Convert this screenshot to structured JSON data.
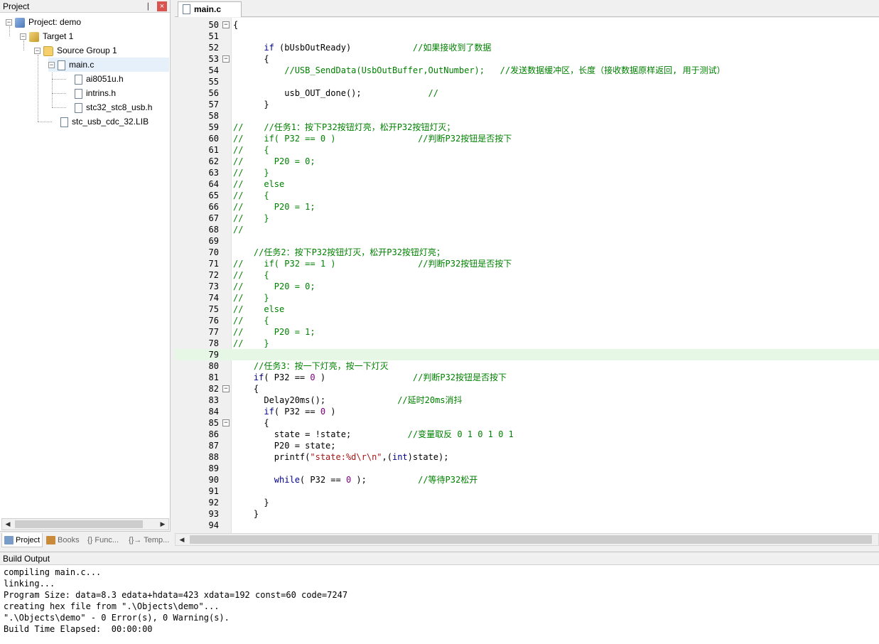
{
  "project_panel": {
    "title": "Project",
    "pin_glyph": "❘",
    "close_glyph": "×",
    "tree": [
      {
        "label": "Project: demo",
        "icon": "project-icon",
        "expander": "−"
      },
      {
        "label": "Target 1",
        "icon": "target-icon",
        "expander": "−"
      },
      {
        "label": "Source Group 1",
        "icon": "folder-icon",
        "expander": "−"
      },
      {
        "label": "main.c",
        "icon": "file-icon",
        "expander": "−"
      },
      {
        "label": "ai8051u.h",
        "icon": "file-icon"
      },
      {
        "label": "intrins.h",
        "icon": "file-icon"
      },
      {
        "label": "stc32_stc8_usb.h",
        "icon": "file-icon"
      },
      {
        "label": "stc_usb_cdc_32.LIB",
        "icon": "file-icon"
      }
    ],
    "bottom_tabs": [
      "Project",
      "Books",
      "{} Func...",
      "{}→ Temp..."
    ]
  },
  "editor": {
    "tab_label": "main.c",
    "lines": [
      {
        "n": "50",
        "fold": "−",
        "segs": [
          {
            "t": "{",
            "c": ""
          }
        ]
      },
      {
        "n": "51",
        "fold": "",
        "segs": []
      },
      {
        "n": "52",
        "fold": "",
        "segs": [
          {
            "t": "      ",
            "c": ""
          },
          {
            "t": "if",
            "c": "kw"
          },
          {
            "t": " (bUsbOutReady)            ",
            "c": ""
          },
          {
            "t": "//如果接收到了数据",
            "c": "cm"
          }
        ]
      },
      {
        "n": "53",
        "fold": "−",
        "segs": [
          {
            "t": "      {",
            "c": ""
          }
        ]
      },
      {
        "n": "54",
        "fold": "",
        "segs": [
          {
            "t": "          ",
            "c": ""
          },
          {
            "t": "//USB_SendData(UsbOutBuffer,OutNumber);   //发送数据缓冲区，长度（接收数据原样返回, 用于测试）",
            "c": "cm"
          }
        ]
      },
      {
        "n": "55",
        "fold": "",
        "segs": []
      },
      {
        "n": "56",
        "fold": "",
        "segs": [
          {
            "t": "          usb_OUT_done();             ",
            "c": ""
          },
          {
            "t": "//",
            "c": "cm"
          }
        ]
      },
      {
        "n": "57",
        "fold": "",
        "segs": [
          {
            "t": "      }",
            "c": ""
          }
        ]
      },
      {
        "n": "58",
        "fold": "",
        "segs": []
      },
      {
        "n": "59",
        "fold": "",
        "segs": [
          {
            "t": "//    //任务1：按下P32按钮灯亮，松开P32按钮灯灭；",
            "c": "cm"
          }
        ]
      },
      {
        "n": "60",
        "fold": "",
        "segs": [
          {
            "t": "//    if( P32 == 0 )                //判断P32按钮是否按下",
            "c": "cm"
          }
        ]
      },
      {
        "n": "61",
        "fold": "",
        "segs": [
          {
            "t": "//    {",
            "c": "cm"
          }
        ]
      },
      {
        "n": "62",
        "fold": "",
        "segs": [
          {
            "t": "//      P20 = 0;",
            "c": "cm"
          }
        ]
      },
      {
        "n": "63",
        "fold": "",
        "segs": [
          {
            "t": "//    }",
            "c": "cm"
          }
        ]
      },
      {
        "n": "64",
        "fold": "",
        "segs": [
          {
            "t": "//    else",
            "c": "cm"
          }
        ]
      },
      {
        "n": "65",
        "fold": "",
        "segs": [
          {
            "t": "//    {",
            "c": "cm"
          }
        ]
      },
      {
        "n": "66",
        "fold": "",
        "segs": [
          {
            "t": "//      P20 = 1;",
            "c": "cm"
          }
        ]
      },
      {
        "n": "67",
        "fold": "",
        "segs": [
          {
            "t": "//    }",
            "c": "cm"
          }
        ]
      },
      {
        "n": "68",
        "fold": "",
        "segs": [
          {
            "t": "//",
            "c": "cm"
          }
        ]
      },
      {
        "n": "69",
        "fold": "",
        "segs": []
      },
      {
        "n": "70",
        "fold": "",
        "segs": [
          {
            "t": "    ",
            "c": ""
          },
          {
            "t": "//任务2：按下P32按钮灯灭，松开P32按钮灯亮；",
            "c": "cm"
          }
        ]
      },
      {
        "n": "71",
        "fold": "",
        "segs": [
          {
            "t": "//    if( P32 == 1 )                //判断P32按钮是否按下",
            "c": "cm"
          }
        ]
      },
      {
        "n": "72",
        "fold": "",
        "segs": [
          {
            "t": "//    {",
            "c": "cm"
          }
        ]
      },
      {
        "n": "73",
        "fold": "",
        "segs": [
          {
            "t": "//      P20 = 0;",
            "c": "cm"
          }
        ]
      },
      {
        "n": "74",
        "fold": "",
        "segs": [
          {
            "t": "//    }",
            "c": "cm"
          }
        ]
      },
      {
        "n": "75",
        "fold": "",
        "segs": [
          {
            "t": "//    else",
            "c": "cm"
          }
        ]
      },
      {
        "n": "76",
        "fold": "",
        "segs": [
          {
            "t": "//    {",
            "c": "cm"
          }
        ]
      },
      {
        "n": "77",
        "fold": "",
        "segs": [
          {
            "t": "//      P20 = 1;",
            "c": "cm"
          }
        ]
      },
      {
        "n": "78",
        "fold": "",
        "segs": [
          {
            "t": "//    }",
            "c": "cm"
          }
        ]
      },
      {
        "n": "79",
        "fold": "",
        "segs": [],
        "current": true
      },
      {
        "n": "80",
        "fold": "",
        "segs": [
          {
            "t": "    ",
            "c": ""
          },
          {
            "t": "//任务3：按一下灯亮，按一下灯灭",
            "c": "cm"
          }
        ]
      },
      {
        "n": "81",
        "fold": "",
        "segs": [
          {
            "t": "    ",
            "c": ""
          },
          {
            "t": "if",
            "c": "kw"
          },
          {
            "t": "( P32 == ",
            "c": ""
          },
          {
            "t": "0",
            "c": "num"
          },
          {
            "t": " )                 ",
            "c": ""
          },
          {
            "t": "//判断P32按钮是否按下",
            "c": "cm"
          }
        ]
      },
      {
        "n": "82",
        "fold": "−",
        "segs": [
          {
            "t": "    {",
            "c": ""
          }
        ]
      },
      {
        "n": "83",
        "fold": "",
        "segs": [
          {
            "t": "      Delay20ms();              ",
            "c": ""
          },
          {
            "t": "//延时20ms消抖",
            "c": "cm"
          }
        ]
      },
      {
        "n": "84",
        "fold": "",
        "segs": [
          {
            "t": "      ",
            "c": ""
          },
          {
            "t": "if",
            "c": "kw"
          },
          {
            "t": "( P32 == ",
            "c": ""
          },
          {
            "t": "0",
            "c": "num"
          },
          {
            "t": " )",
            "c": ""
          }
        ]
      },
      {
        "n": "85",
        "fold": "−",
        "segs": [
          {
            "t": "      {",
            "c": ""
          }
        ]
      },
      {
        "n": "86",
        "fold": "",
        "segs": [
          {
            "t": "        state = !state;           ",
            "c": ""
          },
          {
            "t": "//变量取反 0 1 0 1 0 1",
            "c": "cm"
          }
        ]
      },
      {
        "n": "87",
        "fold": "",
        "segs": [
          {
            "t": "        P20 = state;",
            "c": ""
          }
        ]
      },
      {
        "n": "88",
        "fold": "",
        "segs": [
          {
            "t": "        printf(",
            "c": ""
          },
          {
            "t": "\"state:%d\\r\\n\"",
            "c": "str"
          },
          {
            "t": ",(",
            "c": ""
          },
          {
            "t": "int",
            "c": "kw"
          },
          {
            "t": ")state);",
            "c": ""
          }
        ]
      },
      {
        "n": "89",
        "fold": "",
        "segs": []
      },
      {
        "n": "90",
        "fold": "",
        "segs": [
          {
            "t": "        ",
            "c": ""
          },
          {
            "t": "while",
            "c": "kw"
          },
          {
            "t": "( P32 == ",
            "c": ""
          },
          {
            "t": "0",
            "c": "num"
          },
          {
            "t": " );          ",
            "c": ""
          },
          {
            "t": "//等待P32松开",
            "c": "cm"
          }
        ]
      },
      {
        "n": "91",
        "fold": "",
        "segs": []
      },
      {
        "n": "92",
        "fold": "",
        "segs": [
          {
            "t": "      }",
            "c": ""
          }
        ]
      },
      {
        "n": "93",
        "fold": "",
        "segs": [
          {
            "t": "    }",
            "c": ""
          }
        ]
      },
      {
        "n": "94",
        "fold": "",
        "segs": []
      }
    ]
  },
  "build_output": {
    "title": "Build Output",
    "lines": [
      "compiling main.c...",
      "linking...",
      "Program Size: data=8.3 edata+hdata=423 xdata=192 const=60 code=7247",
      "creating hex file from \".\\Objects\\demo\"...",
      "\".\\Objects\\demo\" - 0 Error(s), 0 Warning(s).",
      "Build Time Elapsed:  00:00:00"
    ]
  },
  "scroll": {
    "left_arrow": "◀",
    "right_arrow": "▶"
  }
}
